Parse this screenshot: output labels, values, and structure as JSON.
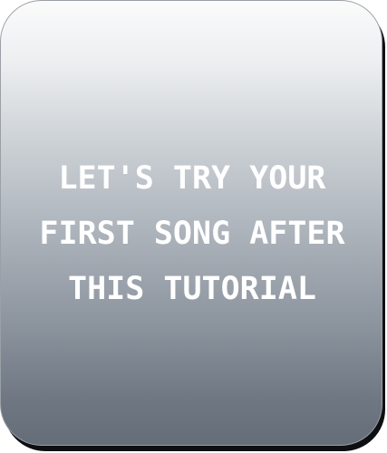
{
  "dialog": {
    "message_lines": [
      "LET'S TRY YOUR",
      "FIRST SONG AFTER",
      "THIS TUTORIAL"
    ]
  },
  "colors": {
    "panel_top": "#fbfbfb",
    "panel_bottom": "#656e78",
    "text": "#ffffff",
    "shadow": "#0d0f12"
  }
}
